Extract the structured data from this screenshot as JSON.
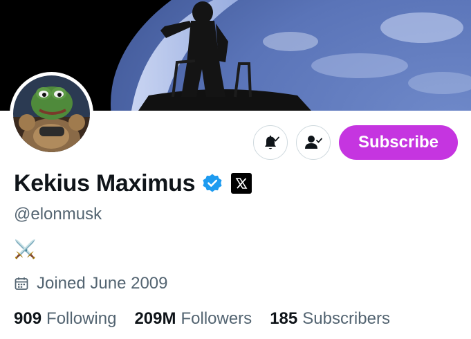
{
  "profile": {
    "display_name": "Kekius Maximus",
    "handle": "@elonmusk",
    "bio": "⚔️",
    "joined": "Joined June 2009"
  },
  "actions": {
    "subscribe_label": "Subscribe"
  },
  "stats": [
    {
      "value": "909",
      "label": "Following"
    },
    {
      "value": "209M",
      "label": "Followers"
    },
    {
      "value": "185",
      "label": "Subscribers"
    }
  ],
  "icons": {
    "notifications": "bell-check-icon",
    "follow": "person-check-icon",
    "verified": "verified-badge-icon",
    "affiliate": "x-logo-icon",
    "calendar": "calendar-icon"
  },
  "colors": {
    "subscribe": "#c535e0",
    "verified": "#1d9bf0",
    "secondary_text": "#536471",
    "primary_text": "#0f1419",
    "border": "#cfd9de"
  }
}
